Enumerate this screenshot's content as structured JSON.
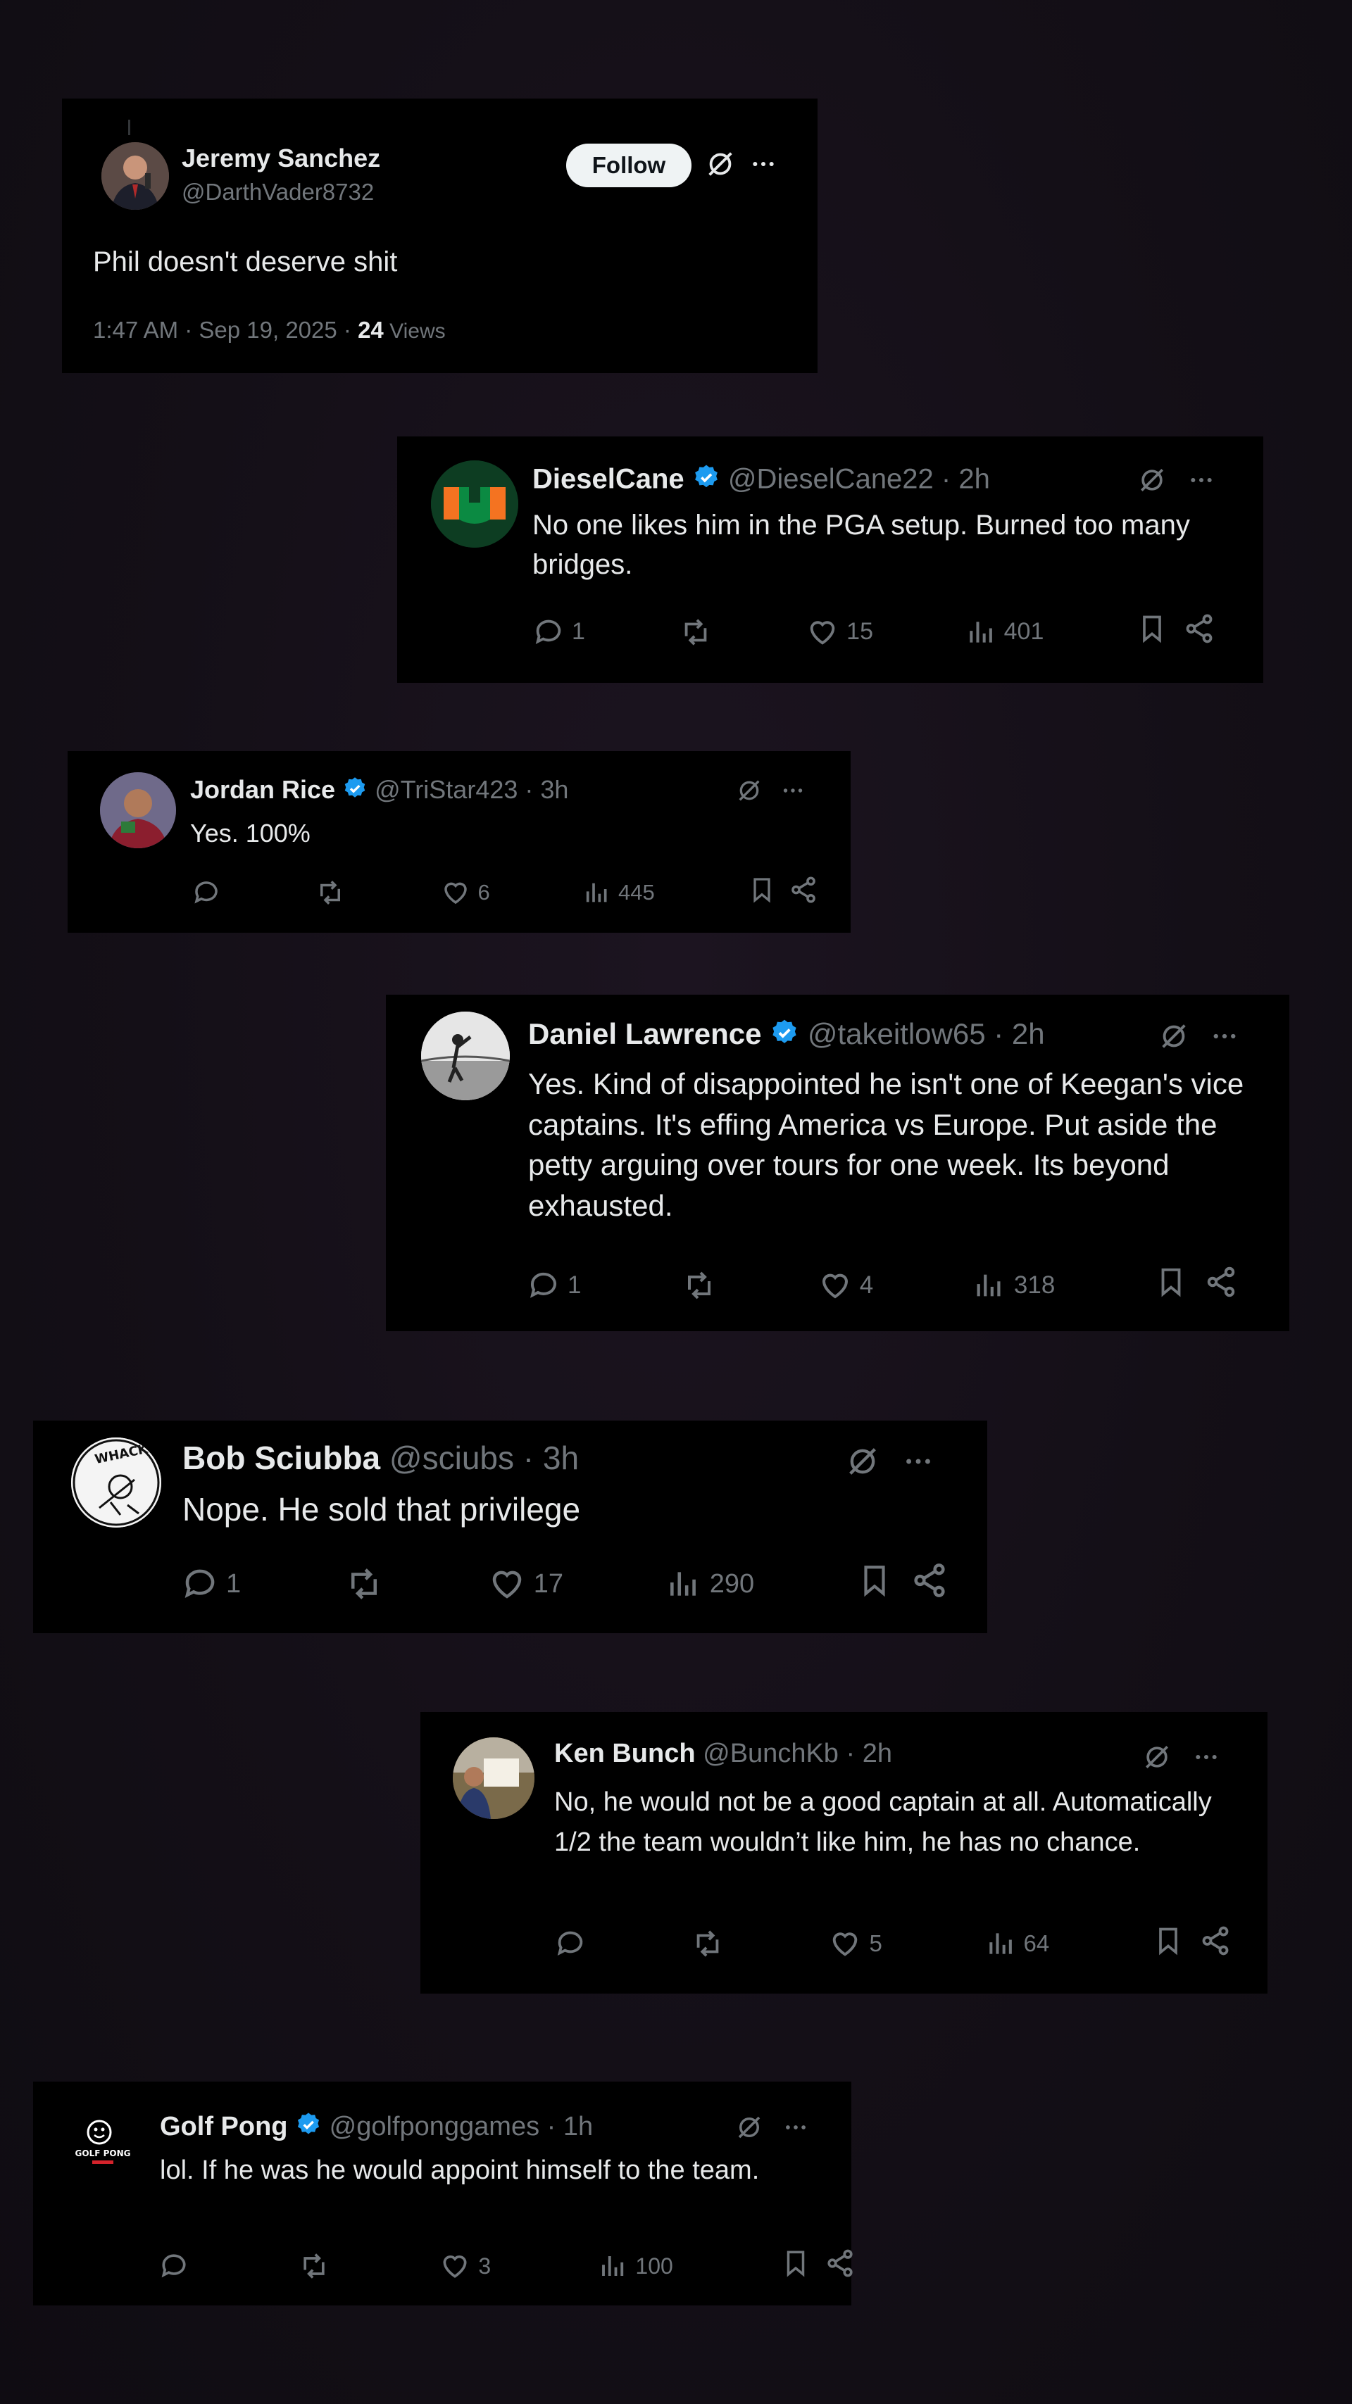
{
  "colors": {
    "background": "#140f17",
    "card": "#000000",
    "text": "#e7e9ea",
    "muted": "#71767b",
    "verified": "#1d9bf0",
    "follow_bg": "#eff3f4"
  },
  "main_post": {
    "name": "Jeremy Sanchez",
    "handle": "@DarthVader8732",
    "follow_label": "Follow",
    "text": "Phil doesn't deserve shit",
    "timestamp": "1:47 AM · Sep 19, 2025 · ",
    "views_count": "24",
    "views_label": " Views"
  },
  "replies": [
    {
      "name": "DieselCane",
      "verified": true,
      "handle": "@DieselCane22 · 2h",
      "text": "No one likes him in the PGA setup. Burned too many bridges.",
      "replies": "1",
      "reposts": "",
      "likes": "15",
      "views": "401"
    },
    {
      "name": "Jordan Rice",
      "verified": true,
      "handle": "@TriStar423 · 3h",
      "text": "Yes. 100%",
      "replies": "",
      "reposts": "",
      "likes": "6",
      "views": "445"
    },
    {
      "name": "Daniel Lawrence",
      "verified": true,
      "handle": "@takeitlow65 · 2h",
      "text": "Yes. Kind of disappointed he isn't one of Keegan's vice captains. It's effing America vs Europe. Put aside the petty arguing over tours for one week. Its beyond exhausted.",
      "replies": "1",
      "reposts": "",
      "likes": "4",
      "views": "318"
    },
    {
      "name": "Bob Sciubba",
      "verified": false,
      "handle": "@sciubs · 3h",
      "text": "Nope.  He sold that privilege",
      "replies": "1",
      "reposts": "",
      "likes": "17",
      "views": "290"
    },
    {
      "name": "Ken Bunch",
      "verified": false,
      "handle": "@BunchKb · 2h",
      "text": "No, he would not be a good captain at all. Automatically 1/2 the team wouldn’t like him, he has no chance.",
      "replies": "",
      "reposts": "",
      "likes": "5",
      "views": "64"
    },
    {
      "name": "Golf Pong",
      "verified": true,
      "handle": "@golfponggames · 1h",
      "text": "lol.  If he was he would appoint himself to the team.",
      "replies": "",
      "reposts": "",
      "likes": "3",
      "views": "100"
    }
  ],
  "avatar_texts": {
    "bob": "WHACK!",
    "golfpong": "GOLF PONG"
  },
  "icons": [
    "grok-icon",
    "more-icon",
    "reply-icon",
    "repost-icon",
    "like-icon",
    "views-icon",
    "bookmark-icon",
    "share-icon",
    "verified-badge-icon"
  ]
}
